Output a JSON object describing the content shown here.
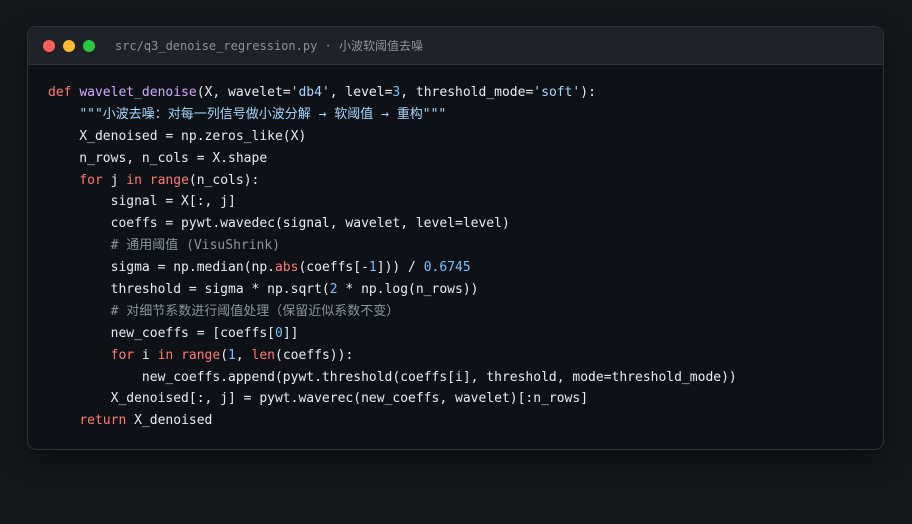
{
  "window": {
    "title": "src/q3_denoise_regression.py · 小波软阈值去噪",
    "controls": [
      "close",
      "minimize",
      "maximize"
    ]
  },
  "colors": {
    "keyword": "#ff7b72",
    "function": "#d2a8ff",
    "string": "#a5d6ff",
    "number": "#79c0ff",
    "comment": "#8b949e",
    "plain": "#e6edf3",
    "background": "#0e1116"
  },
  "code": {
    "lines": [
      [
        [
          "kw",
          "def"
        ],
        [
          "pl",
          " "
        ],
        [
          "fn",
          "wavelet_denoise"
        ],
        [
          "pl",
          "(X, wavelet="
        ],
        [
          "str",
          "'db4'"
        ],
        [
          "pl",
          ", level="
        ],
        [
          "num",
          "3"
        ],
        [
          "pl",
          ", threshold_mode="
        ],
        [
          "str",
          "'soft'"
        ],
        [
          "pl",
          "):"
        ]
      ],
      [
        [
          "pl",
          "    "
        ],
        [
          "str",
          "\"\"\"小波去噪：对每一列信号做小波分解 → 软阈值 → 重构\"\"\""
        ]
      ],
      [
        [
          "pl",
          "    X_denoised = np.zeros_like(X)"
        ]
      ],
      [
        [
          "pl",
          "    n_rows, n_cols = X.shape"
        ]
      ],
      [
        [
          "pl",
          "    "
        ],
        [
          "kw",
          "for"
        ],
        [
          "pl",
          " j "
        ],
        [
          "kw",
          "in"
        ],
        [
          "pl",
          " "
        ],
        [
          "kw",
          "range"
        ],
        [
          "pl",
          "(n_cols):"
        ]
      ],
      [
        [
          "pl",
          "        signal = X[:, j]"
        ]
      ],
      [
        [
          "pl",
          "        coeffs = pywt.wavedec(signal, wavelet, level=level)"
        ]
      ],
      [
        [
          "pl",
          "        "
        ],
        [
          "cm",
          "# 通用阈值 (VisuShrink)"
        ]
      ],
      [
        [
          "pl",
          "        sigma = np.median(np."
        ],
        [
          "kw",
          "abs"
        ],
        [
          "pl",
          "(coeffs[-"
        ],
        [
          "num",
          "1"
        ],
        [
          "pl",
          "])) / "
        ],
        [
          "num",
          "0.6745"
        ]
      ],
      [
        [
          "pl",
          "        threshold = sigma * np.sqrt("
        ],
        [
          "num",
          "2"
        ],
        [
          "pl",
          " * np.log(n_rows))"
        ]
      ],
      [
        [
          "pl",
          "        "
        ],
        [
          "cm",
          "# 对细节系数进行阈值处理（保留近似系数不变）"
        ]
      ],
      [
        [
          "pl",
          "        new_coeffs = [coeffs["
        ],
        [
          "num",
          "0"
        ],
        [
          "pl",
          "]]"
        ]
      ],
      [
        [
          "pl",
          "        "
        ],
        [
          "kw",
          "for"
        ],
        [
          "pl",
          " i "
        ],
        [
          "kw",
          "in"
        ],
        [
          "pl",
          " "
        ],
        [
          "kw",
          "range"
        ],
        [
          "pl",
          "("
        ],
        [
          "num",
          "1"
        ],
        [
          "pl",
          ", "
        ],
        [
          "kw",
          "len"
        ],
        [
          "pl",
          "(coeffs)):"
        ]
      ],
      [
        [
          "pl",
          "            new_coeffs.append(pywt.threshold(coeffs[i], threshold, mode=threshold_mode))"
        ]
      ],
      [
        [
          "pl",
          "        X_denoised[:, j] = pywt.waverec(new_coeffs, wavelet)[:n_rows]"
        ]
      ],
      [
        [
          "pl",
          "    "
        ],
        [
          "kw",
          "return"
        ],
        [
          "pl",
          " X_denoised"
        ]
      ]
    ]
  }
}
